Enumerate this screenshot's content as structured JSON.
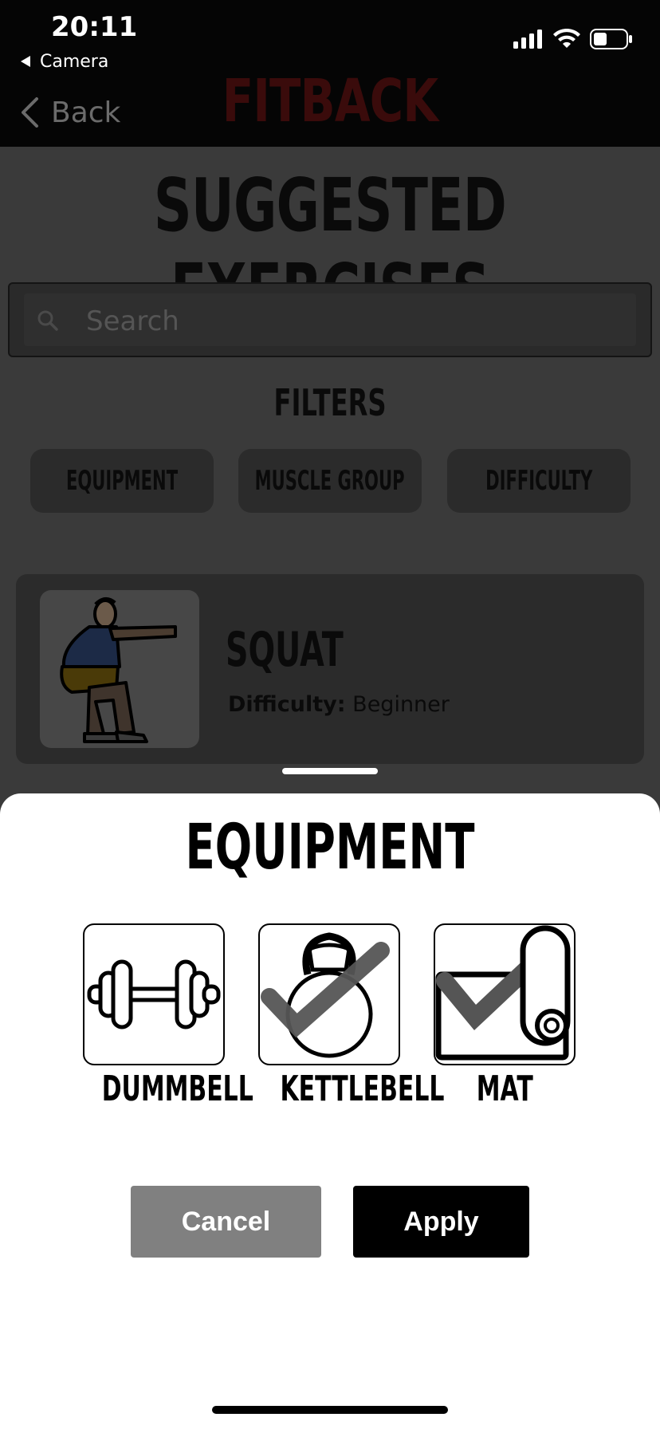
{
  "status_bar": {
    "time": "20:11",
    "back_app": "Camera"
  },
  "nav": {
    "back_label": "Back",
    "brand": "FITBACK"
  },
  "page": {
    "title": "SUGGESTED EXERCISES"
  },
  "search": {
    "placeholder": "Search"
  },
  "filters": {
    "title": "FILTERS",
    "chips": [
      "EQUIPMENT",
      "MUSCLE GROUP",
      "DIFFICULTY"
    ]
  },
  "exercise": {
    "name": "SQUAT",
    "difficulty_label": "Difficulty:",
    "difficulty_value": "Beginner"
  },
  "sheet": {
    "title": "EQUIPMENT",
    "options": [
      {
        "label": "DUMMBELL",
        "icon": "dumbbell-icon",
        "selected": false
      },
      {
        "label": "KETTLEBELL",
        "icon": "kettlebell-icon",
        "selected": true
      },
      {
        "label": "MAT",
        "icon": "mat-icon",
        "selected": true
      }
    ],
    "cancel_label": "Cancel",
    "apply_label": "Apply"
  },
  "colors": {
    "check": "#555555",
    "brand": "#3a0b0b",
    "cancel": "#808080",
    "apply": "#000000"
  }
}
